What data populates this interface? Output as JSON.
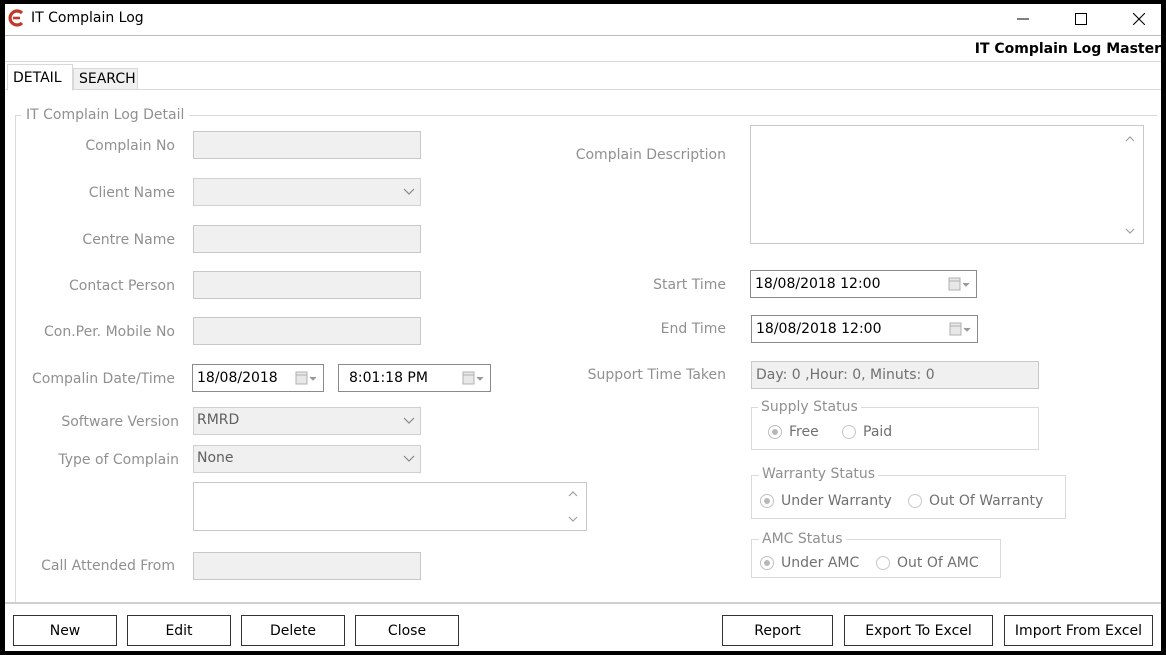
{
  "window": {
    "title": "IT Complain Log",
    "icon": "app-logo-icon",
    "controls": [
      "minimize-icon",
      "maximize-icon",
      "close-icon"
    ]
  },
  "header": {
    "master_title": "IT Complain Log Master"
  },
  "tabs": [
    {
      "label": "DETAIL",
      "active": true
    },
    {
      "label": "SEARCH",
      "active": false
    }
  ],
  "group": {
    "legend": "IT Complain Log Detail"
  },
  "left_form": {
    "complain_no": {
      "label": "Complain No",
      "value": ""
    },
    "client_name": {
      "label": "Client Name",
      "value": ""
    },
    "centre_name": {
      "label": "Centre Name",
      "value": ""
    },
    "contact_person": {
      "label": "Contact Person",
      "value": ""
    },
    "mobile_no": {
      "label": "Con.Per. Mobile No",
      "value": ""
    },
    "complain_datetime": {
      "label": "Compalin Date/Time",
      "date": "18/08/2018",
      "time": "8:01:18 PM"
    },
    "software_version": {
      "label": "Software Version",
      "value": "RMRD"
    },
    "type_of_complain": {
      "label": "Type of Complain",
      "value": "None"
    },
    "type_notes": {
      "value": ""
    },
    "call_attended_from": {
      "label": "Call Attended From",
      "value": ""
    }
  },
  "right_form": {
    "complain_description": {
      "label": "Complain Description",
      "value": ""
    },
    "start_time": {
      "label": "Start Time",
      "value": "18/08/2018 12:00"
    },
    "end_time": {
      "label": "End Time",
      "value": "18/08/2018 12:00"
    },
    "support_time_taken": {
      "label": "Support Time Taken",
      "value": "Day: 0 ,Hour: 0, Minuts: 0"
    },
    "supply_status": {
      "legend": "Supply Status",
      "options": [
        "Free",
        "Paid"
      ],
      "selected": "Free"
    },
    "warranty_status": {
      "legend": "Warranty Status",
      "options": [
        "Under Warranty",
        "Out Of Warranty"
      ],
      "selected": "Under Warranty"
    },
    "amc_status": {
      "legend": "AMC Status",
      "options": [
        "Under AMC",
        "Out Of AMC"
      ],
      "selected": "Under AMC"
    }
  },
  "buttons": {
    "new": "New",
    "edit": "Edit",
    "delete": "Delete",
    "close": "Close",
    "report": "Report",
    "export": "Export To  Excel",
    "import": "Import From Excel"
  },
  "colors": {
    "logo": "#c0392b",
    "label": "#909090",
    "field_bg": "#f0f0f0"
  }
}
